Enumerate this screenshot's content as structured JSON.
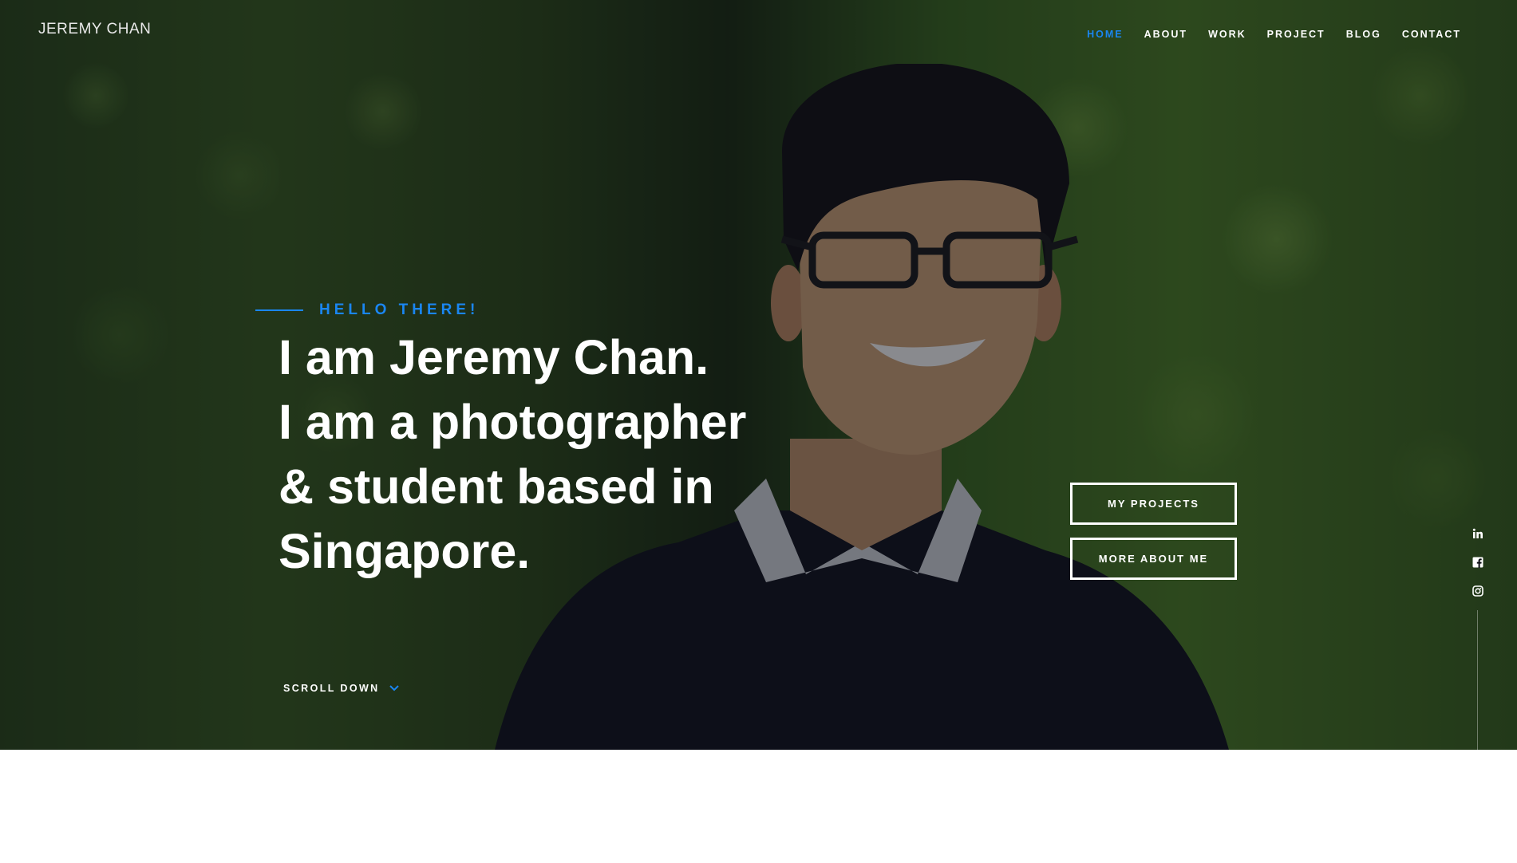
{
  "brand": {
    "name": "JEREMY CHAN"
  },
  "nav": {
    "items": [
      {
        "label": "HOME",
        "active": true
      },
      {
        "label": "ABOUT",
        "active": false
      },
      {
        "label": "WORK",
        "active": false
      },
      {
        "label": "PROJECT",
        "active": false
      },
      {
        "label": "BLOG",
        "active": false
      },
      {
        "label": "CONTACT",
        "active": false
      }
    ]
  },
  "hero": {
    "kicker": "HELLO THERE!",
    "headline": [
      "I am Jeremy Chan.",
      "I am a photographer",
      "& student based in",
      "Singapore."
    ],
    "scroll_label": "SCROLL DOWN",
    "buttons": {
      "projects": "MY PROJECTS",
      "about": "MORE ABOUT ME"
    }
  },
  "social": {
    "icons": [
      "linkedin-icon",
      "facebook-icon",
      "instagram-icon"
    ]
  },
  "colors": {
    "accent": "#1a86f2",
    "text": "#ffffff",
    "background": "#ffffff"
  }
}
